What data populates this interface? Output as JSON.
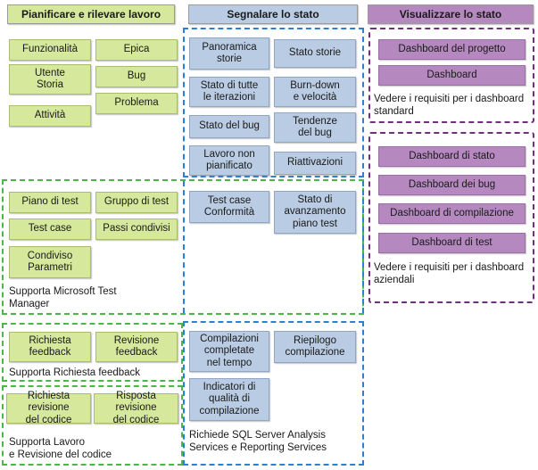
{
  "columns": {
    "left": {
      "title": "Pianificare e rilevare lavoro",
      "color": "#d6e89b"
    },
    "middle": {
      "title": "Segnalare lo stato",
      "color": "#b9cce3"
    },
    "right": {
      "title": "Visualizzare lo stato",
      "color": "#b588c0"
    }
  },
  "left_column": {
    "plan_items": [
      "Funzionalità",
      "Epica",
      "Utente\nStoria",
      "Bug",
      "Problema",
      "Attività"
    ],
    "test_items": [
      "Piano di test",
      "Gruppo di test",
      "Test case",
      "Passi condivisi",
      "Condiviso\nParametri"
    ],
    "test_note": "Supporta Microsoft Test\nManager",
    "feedback_items": [
      "Richiesta\nfeedback",
      "Revisione\nfeedback"
    ],
    "feedback_note": "Supporta Richiesta feedback",
    "code_items": [
      "Richiesta revisione\ndel codice",
      "Risposta revisione\ndel codice"
    ],
    "code_note": "Supporta Lavoro\ne Revisione del codice"
  },
  "middle_column": {
    "status_items": [
      "Panoramica\nstorie",
      "Stato storie",
      "Stato di tutte\nle iterazioni",
      "Burn-down\ne velocità",
      "Stato del bug",
      "Tendenze\ndel bug",
      "Lavoro non\npianificato",
      "Riattivazioni"
    ],
    "test_items": [
      "Test case\nConformità",
      "Stato di\navanzamento\npiano test"
    ],
    "build_items": [
      "Compilazioni\ncompletate\nnel tempo",
      "Riepilogo\ncompilazione",
      "Indicatori di\nqualità di\ncompilazione"
    ],
    "build_note": "Richiede SQL Server Analysis\nServices e Reporting Services"
  },
  "right_column": {
    "standard_items": [
      "Dashboard del progetto",
      "Dashboard"
    ],
    "standard_note": "Vedere i requisiti per i dashboard\nstandard",
    "enterprise_items": [
      "Dashboard di stato",
      "Dashboard dei bug",
      "Dashboard di compilazione",
      "Dashboard di test"
    ],
    "enterprise_note": "Vedere i requisiti per i dashboard\naziendali"
  }
}
